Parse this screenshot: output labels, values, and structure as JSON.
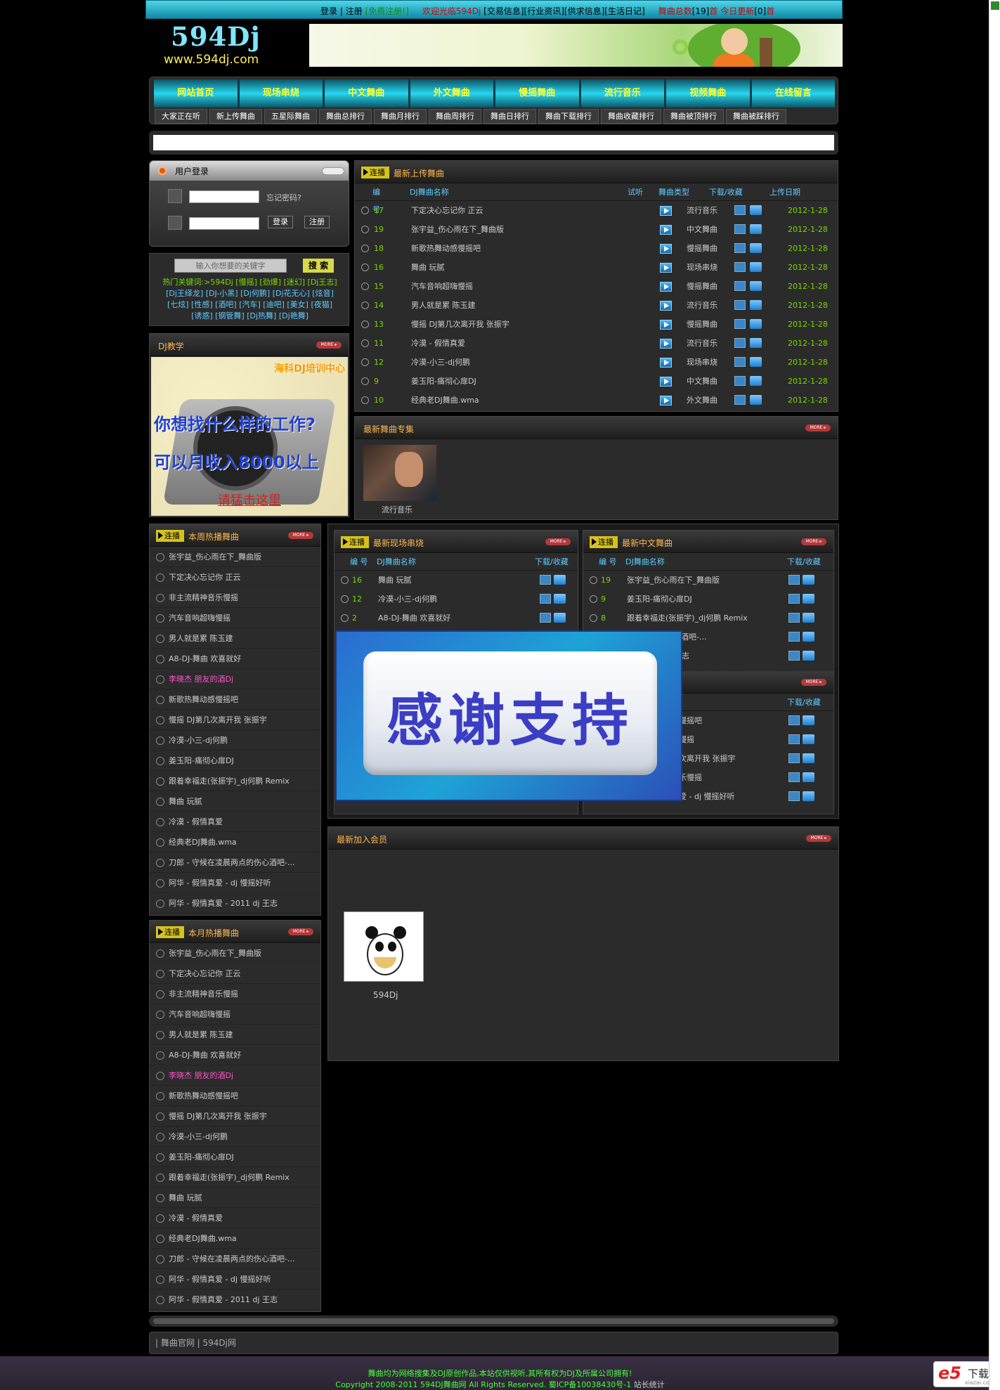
{
  "topbar": {
    "login": "登录",
    "sep": "|",
    "register": "注册",
    "free_register": "[免费注册!]",
    "red_msg": "欢迎光临594Dj",
    "links": [
      "[交易信息]",
      "[行业资讯]",
      "[供求信息]",
      "[生活日记]"
    ],
    "online_label": "舞曲总数",
    "online_count": "[19]",
    "online_sep": "首",
    "today_label": "今日更新",
    "today_count": "[0]",
    "today_sep": "首"
  },
  "logo": {
    "title": "594Dj",
    "url": "www.594dj.com"
  },
  "nav": {
    "main": [
      "网站首页",
      "现场串烧",
      "中文舞曲",
      "外文舞曲",
      "慢摇舞曲",
      "流行音乐",
      "视频舞曲",
      "在线留言"
    ],
    "sub": [
      "大家正在听",
      "新上传舞曲",
      "五星际舞曲",
      "舞曲总排行",
      "舞曲月排行",
      "舞曲周排行",
      "舞曲日排行",
      "舞曲下载排行",
      "舞曲收藏排行",
      "舞曲被顶排行",
      "舞曲被踩排行"
    ]
  },
  "login_box": {
    "title": "用户登录",
    "forgot": "忘记密码?",
    "login_btn": "登录",
    "register_btn": "注册"
  },
  "search": {
    "placeholder": "输入你想要的关键字",
    "button": "搜 索",
    "hot_label": "热门关键词:",
    "line1": ">594Dj [慢摇] [劲爆] [迷幻] [Dj王志]",
    "line2": "[Dj王绎龙] [DJ-小黑] [Dj何鹏] [Dj花无心] [炫音]",
    "line3": "[七炫] [性感] [酒吧] [汽车] [迪吧] [美女] [夜猫]",
    "line4": "[诱惑] [钢管舞] [Dj热舞] [Dj艳舞]"
  },
  "teach": {
    "title": "DJ教学",
    "more": "MORE ▸",
    "ad_top": "海科DJ培训中心",
    "ad_line1": "你想找什么样的工作?",
    "ad_line2": "可以月收入8000以上",
    "ad_line3": "请猛击这里"
  },
  "newup": {
    "tag": "连播",
    "title": "最新上传舞曲",
    "cols": [
      "编 号",
      "DJ舞曲名称",
      "试听",
      "舞曲类型",
      "下载/收藏",
      "上传日期"
    ],
    "rows": [
      {
        "id": "17",
        "name": "下定决心忘记你 正云",
        "type": "流行音乐",
        "date": "2012-1-28"
      },
      {
        "id": "19",
        "name": "张宇益_伤心雨在下_舞曲版",
        "type": "中文舞曲",
        "date": "2012-1-28"
      },
      {
        "id": "18",
        "name": "新歌热舞动感慢摇吧",
        "type": "慢摇舞曲",
        "date": "2012-1-28"
      },
      {
        "id": "16",
        "name": "舞曲 玩腻",
        "type": "现场串烧",
        "date": "2012-1-28"
      },
      {
        "id": "15",
        "name": "汽车音响超嗨慢摇",
        "type": "慢摇舞曲",
        "date": "2012-1-28"
      },
      {
        "id": "14",
        "name": "男人就是累 陈玉建",
        "type": "流行音乐",
        "date": "2012-1-28"
      },
      {
        "id": "13",
        "name": "慢摇 DJ第几次离开我 张振宇",
        "type": "慢摇舞曲",
        "date": "2012-1-28"
      },
      {
        "id": "11",
        "name": "冷漠 - 假情真爱",
        "type": "流行音乐",
        "date": "2012-1-28"
      },
      {
        "id": "12",
        "name": "冷漠-小三-dj何鹏",
        "type": "现场串烧",
        "date": "2012-1-28"
      },
      {
        "id": "9",
        "name": "姜玉阳-痛彻心扉DJ",
        "type": "中文舞曲",
        "date": "2012-1-28"
      },
      {
        "id": "10",
        "name": "经典老DJ舞曲.wma",
        "type": "外文舞曲",
        "date": "2012-1-28"
      }
    ]
  },
  "zhuanji": {
    "title": "最新舞曲专集",
    "album": "流行音乐",
    "more": "MORE ▸"
  },
  "weekhot": {
    "tag": "连播",
    "title": "本周热播舞曲",
    "more": "MORE ▸",
    "items": [
      "张宇益_伤心雨在下_舞曲版",
      "下定决心忘记你 正云",
      "非主流精神音乐慢摇",
      "汽车音响超嗨慢摇",
      "男人就是累 陈玉建",
      "A8-DJ-舞曲 欢喜就好",
      "李晓杰 朋友的酒Dj",
      "新歌热舞动感慢摇吧",
      "慢摇 DJ第几次离开我 张振宇",
      "冷漠-小三-dj何鹏",
      "姜玉阳-痛彻心扉DJ",
      "跟着幸福走(张振宇)_dj何鹏 Remix",
      "舞曲 玩腻",
      "冷漠 - 假情真爱",
      "经典老DJ舞曲.wma",
      "刀郎 - 守候在凌晨两点的伤心酒吧-...",
      "阿华 - 假情真爱 - dj 慢摇好听",
      "阿华 - 假情真爱 - 2011 dj 王志"
    ]
  },
  "monthhot": {
    "tag": "连播",
    "title": "本月热播舞曲",
    "more": "MORE ▸",
    "items": [
      "张宇益_伤心雨在下_舞曲版",
      "下定决心忘记你 正云",
      "非主流精神音乐慢摇",
      "汽车音响超嗨慢摇",
      "男人就是累 陈玉建",
      "A8-DJ-舞曲 欢喜就好",
      "李晓杰 朋友的酒Dj",
      "新歌热舞动感慢摇吧",
      "慢摇 DJ第几次离开我 张振宇",
      "冷漠-小三-dj何鹏",
      "姜玉阳-痛彻心扉DJ",
      "跟着幸福走(张振宇)_dj何鹏 Remix",
      "舞曲 玩腻",
      "冷漠 - 假情真爱",
      "经典老DJ舞曲.wma",
      "刀郎 - 守候在凌晨两点的伤心酒吧-...",
      "阿华 - 假情真爱 - dj 慢摇好听",
      "阿华 - 假情真爱 - 2011 dj 王志"
    ]
  },
  "chuanshao": {
    "tag": "连播",
    "title": "最新现场串烧",
    "more": "MORE ▸",
    "cols": [
      "编 号",
      "DJ舞曲名称",
      "下载/收藏"
    ],
    "rows": [
      {
        "id": "16",
        "name": "舞曲 玩腻"
      },
      {
        "id": "12",
        "name": "冷漠-小三-dj何鹏"
      },
      {
        "id": "2",
        "name": "A8-DJ-舞曲 欢喜就好"
      }
    ]
  },
  "zhongwen": {
    "tag": "连播",
    "title": "最新中文舞曲",
    "more": "MORE ▸",
    "cols": [
      "编 号",
      "DJ舞曲名称",
      "下载/收藏"
    ],
    "rows": [
      {
        "id": "19",
        "name": "张宇益_伤心雨在下_舞曲版"
      },
      {
        "id": "9",
        "name": "姜玉阳-痛彻心扉DJ"
      },
      {
        "id": "8",
        "name": "跟着幸福走(张振宇)_dj何鹏 Remix"
      },
      {
        "id": "",
        "name": "凌晨两点的伤心酒吧-..."
      },
      {
        "id": "",
        "name": "爱 - 2011 dj 王志"
      }
    ],
    "lower_col": "下载/收藏",
    "lower_rows": [
      "慢摇吧",
      "慢摇",
      "次离开我 张振宇",
      "乐慢摇",
      "爱 - dj 慢摇好听"
    ]
  },
  "popup": {
    "text": "感谢支持"
  },
  "members": {
    "title": "最新加入会员",
    "more": "MORE ▸",
    "name": "594Dj"
  },
  "friend": {
    "text": "| 舞曲官网 | 594Dj网"
  },
  "footer": {
    "line1": "舞曲均为网络搜集及DJ原创作品,本站仅供视听,其所有权为DJ及所属公司拥有!",
    "line2": "Copyright 2008-2011 594DJ舞曲网 All Rights Reserved. 蜀ICP备10038430号-1",
    "stat": "站长统计"
  },
  "e5": {
    "brand": "e5",
    "label": "下载",
    "site": "xiazai.com"
  }
}
